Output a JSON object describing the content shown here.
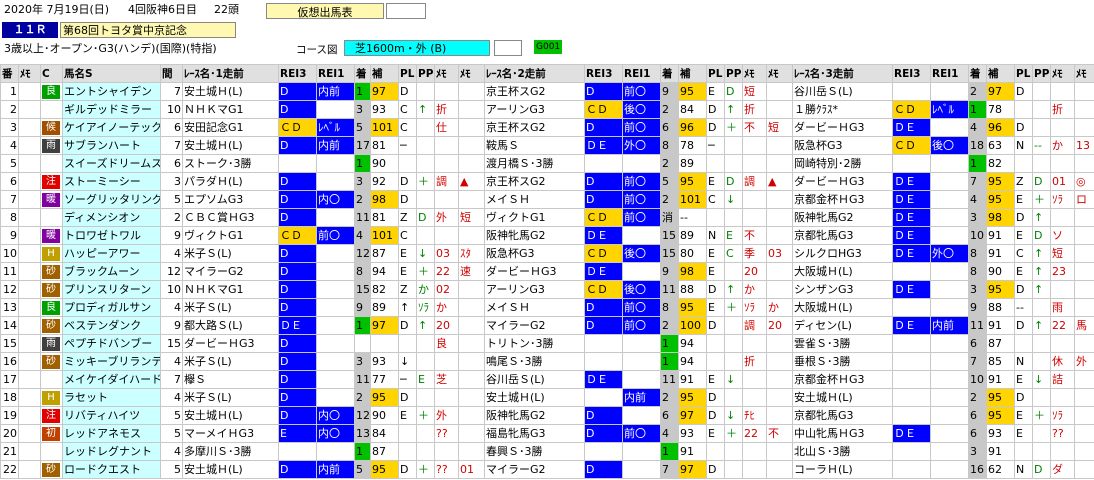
{
  "header": {
    "date": "2020年 7月19日(日)",
    "meet": "4回阪神6日目",
    "runners": "22頭",
    "tab": "仮想出馬表",
    "race_no": "１１Ｒ",
    "race_name": "第68回トヨタ賞中京記念",
    "conditions": "3歳以上･オープン･G3(ハンデ)(国際)(特指)",
    "course_label": "コース図",
    "course": "芝1600m・外 (B)",
    "code": "G001"
  },
  "cols": [
    "番",
    "ﾒﾓ",
    "C",
    "馬名S",
    "間",
    "ﾚｰｽ名･1走前",
    "REI3",
    "REI1",
    "着",
    "補",
    "PL",
    "PP",
    "ﾒﾓ",
    "ﾒﾓ",
    "ﾚｰｽ名･2走前",
    "REI3",
    "REI1",
    "着",
    "補",
    "PL",
    "PP",
    "ﾒﾓ",
    "ﾒﾓ",
    "ﾚｰｽ名･3走前",
    "REI3",
    "REI1",
    "着",
    "補",
    "PL",
    "PP",
    "ﾒﾓ",
    "ﾒﾓ"
  ],
  "horses": [
    {
      "n": "1",
      "mk": "良",
      "mc": "#00a000",
      "name": "エントシャイデン",
      "gap": "7",
      "r1": "安土城Ｈ(L)",
      "r1a": "D",
      "r1b": "内前",
      "r1c": "1",
      "r1d": "97",
      "r1e": "D",
      "r1f": "",
      "r1g": "",
      "r1h": "",
      "r2": "京王杯スG2",
      "r2a": "D",
      "r2b": "前〇",
      "r2c": "9",
      "r2d": "95",
      "r2e": "E",
      "r2f": "D",
      "r2g": "短",
      "r2h": "",
      "r3": "谷川岳Ｓ(L)",
      "r3a": "",
      "r3b": "",
      "r3c": "2",
      "r3d": "97",
      "r3e": "D",
      "r3f": "",
      "r3g": "",
      "r3h": ""
    },
    {
      "n": "2",
      "mk": "",
      "mc": "",
      "name": "ギルデッドミラー",
      "gap": "10",
      "r1": "ＮＨＫマG1",
      "r1a": "D",
      "r1b": "",
      "r1c": "3",
      "r1d": "93",
      "r1e": "C",
      "r1f": "↑",
      "r1g": "折",
      "r1h": "",
      "r2": "アーリンG3",
      "r2a": "ＣＤ",
      "r2b": "後〇",
      "r2c": "2",
      "r2d": "84",
      "r2e": "D",
      "r2f": "↑",
      "r2g": "折",
      "r2h": "",
      "r3": "１勝ｸﾗｽ*",
      "r3a": "ＣＤ",
      "r3b": "ﾚﾍﾞﾙ",
      "r3c": "1",
      "r3d": "78",
      "r3e": "",
      "r3f": "",
      "r3g": "折",
      "r3h": ""
    },
    {
      "n": "3",
      "mk": "候",
      "mc": "#a05000",
      "name": "ケイアイノーテック",
      "gap": "6",
      "r1": "安田記念G1",
      "r1a": "ＣＤ",
      "r1b": "ﾚﾍﾞﾙ",
      "r1c": "5",
      "r1d": "101",
      "r1e": "C",
      "r1f": "",
      "r1g": "仕",
      "r1h": "",
      "r2": "京王杯スG2",
      "r2a": "D",
      "r2b": "前〇",
      "r2c": "6",
      "r2d": "96",
      "r2e": "D",
      "r2f": "＋",
      "r2g": "不",
      "r2h": "短",
      "r3": "ダービーＨG3",
      "r3a": "ＤＥ",
      "r3b": "",
      "r3c": "4",
      "r3d": "96",
      "r3e": "D",
      "r3f": "",
      "r3g": "",
      "r3h": ""
    },
    {
      "n": "4",
      "mk": "雨",
      "mc": "#404040",
      "name": "サブランハート",
      "gap": "7",
      "r1": "安土城Ｈ(L)",
      "r1a": "D",
      "r1b": "内前",
      "r1c": "17",
      "r1d": "81",
      "r1e": "─",
      "r1f": "",
      "r1g": "",
      "r1h": "",
      "r2": "鞍馬Ｓ",
      "r2a": "ＤＥ",
      "r2b": "外〇",
      "r2c": "8",
      "r2d": "78",
      "r2e": "─",
      "r2f": "",
      "r2g": "",
      "r2h": "",
      "r3": "阪急杯G3",
      "r3a": "ＣＤ",
      "r3b": "後〇",
      "r3c": "18",
      "r3d": "63",
      "r3e": "N",
      "r3f": "--",
      "r3g": "か",
      "r3h": "13"
    },
    {
      "n": "5",
      "mk": "",
      "mc": "",
      "name": "スイーズドリームス",
      "gap": "6",
      "r1": "ストーク･3勝",
      "r1a": "",
      "r1b": "",
      "r1c": "1",
      "r1d": "90",
      "r1e": "",
      "r1f": "",
      "r1g": "",
      "r1h": "",
      "r2": "渡月橋Ｓ･3勝",
      "r2a": "",
      "r2b": "",
      "r2c": "2",
      "r2d": "89",
      "r2e": "",
      "r2f": "",
      "r2g": "",
      "r2h": "",
      "r3": "岡崎特別･2勝",
      "r3a": "",
      "r3b": "",
      "r3c": "1",
      "r3d": "82",
      "r3e": "",
      "r3f": "",
      "r3g": "",
      "r3h": ""
    },
    {
      "n": "6",
      "mk": "注",
      "mc": "#e00000",
      "name": "ストーミーシー",
      "gap": "3",
      "r1": "パラダＨ(L)",
      "r1a": "D",
      "r1b": "",
      "r1c": "3",
      "r1d": "92",
      "r1e": "D",
      "r1f": "＋",
      "r1g": "調",
      "r1h": "▲",
      "r2": "京王杯スG2",
      "r2a": "D",
      "r2b": "前〇",
      "r2c": "5",
      "r2d": "95",
      "r2e": "E",
      "r2f": "D",
      "r2g": "調",
      "r2h": "▲",
      "r3": "ダービーＨG3",
      "r3a": "ＤＥ",
      "r3b": "",
      "r3c": "7",
      "r3d": "95",
      "r3e": "Z",
      "r3f": "D",
      "r3g": "01",
      "r3h": "◎"
    },
    {
      "n": "7",
      "mk": "暖",
      "mc": "#8000a0",
      "name": "ソーグリッタリング",
      "gap": "5",
      "r1": "エプソムG3",
      "r1a": "D",
      "r1b": "内〇",
      "r1c": "2",
      "r1d": "98",
      "r1e": "D",
      "r1f": "",
      "r1g": "",
      "r1h": "",
      "r2": "メイＳＨ",
      "r2a": "D",
      "r2b": "前〇",
      "r2c": "2",
      "r2d": "101",
      "r2e": "C",
      "r2f": "↓",
      "r2g": "",
      "r2h": "",
      "r3": "京都金杯ＨG3",
      "r3a": "ＤＥ",
      "r3b": "",
      "r3c": "4",
      "r3d": "95",
      "r3e": "E",
      "r3f": "＋",
      "r3g": "ｿﾗ",
      "r3h": "ロ"
    },
    {
      "n": "8",
      "mk": "",
      "mc": "",
      "name": "ディメンシオン",
      "gap": "2",
      "r1": "ＣＢＣ賞ＨG3",
      "r1a": "D",
      "r1b": "",
      "r1c": "11",
      "r1d": "81",
      "r1e": "Z",
      "r1f": "D",
      "r1g": "外",
      "r1h": "短",
      "r2": "ヴィクトG1",
      "r2a": "ＣＤ",
      "r2b": "前〇",
      "r2c": "消",
      "r2d": "--",
      "r2e": "",
      "r2f": "",
      "r2g": "",
      "r2h": "",
      "r3": "阪神牝馬G2",
      "r3a": "ＤＥ",
      "r3b": "",
      "r3c": "3",
      "r3d": "98",
      "r3e": "D",
      "r3f": "↑",
      "r3g": "",
      "r3h": ""
    },
    {
      "n": "9",
      "mk": "暖",
      "mc": "#8000a0",
      "name": "トロワゼトワル",
      "gap": "9",
      "r1": "ヴィクトG1",
      "r1a": "ＣＤ",
      "r1b": "前〇",
      "r1c": "4",
      "r1d": "101",
      "r1e": "C",
      "r1f": "",
      "r1g": "",
      "r1h": "",
      "r2": "阪神牝馬G2",
      "r2a": "ＤＥ",
      "r2b": "",
      "r2c": "15",
      "r2d": "89",
      "r2e": "N",
      "r2f": "E",
      "r2g": "不",
      "r2h": "",
      "r3": "京都牝馬G3",
      "r3a": "ＤＥ",
      "r3b": "",
      "r3c": "10",
      "r3d": "91",
      "r3e": "E",
      "r3f": "D",
      "r3g": "ソ",
      "r3h": ""
    },
    {
      "n": "10",
      "mk": "H",
      "mc": "#c0a000",
      "name": "ハッピーアワー",
      "gap": "4",
      "r1": "米子Ｓ(L)",
      "r1a": "D",
      "r1b": "",
      "r1c": "12",
      "r1d": "87",
      "r1e": "E",
      "r1f": "↓",
      "r1g": "03",
      "r1h": "ｽﾀ",
      "r2": "阪急杯G3",
      "r2a": "ＣＤ",
      "r2b": "後〇",
      "r2c": "15",
      "r2d": "80",
      "r2e": "E",
      "r2f": "C",
      "r2g": "季",
      "r2h": "03",
      "r3": "シルクロHG3",
      "r3a": "ＤＥ",
      "r3b": "外〇",
      "r3c": "8",
      "r3d": "91",
      "r3e": "C",
      "r3f": "↑",
      "r3g": "短",
      "r3h": ""
    },
    {
      "n": "11",
      "mk": "砂",
      "mc": "#a06000",
      "name": "ブラックムーン",
      "gap": "12",
      "r1": "マイラーG2",
      "r1a": "D",
      "r1b": "",
      "r1c": "8",
      "r1d": "94",
      "r1e": "E",
      "r1f": "＋",
      "r1g": "22",
      "r1h": "速",
      "r2": "ダービーＨG3",
      "r2a": "ＤＥ",
      "r2b": "",
      "r2c": "9",
      "r2d": "98",
      "r2e": "E",
      "r2f": "",
      "r2g": "20",
      "r2h": "",
      "r3": "大阪城Ｈ(L)",
      "r3a": "",
      "r3b": "",
      "r3c": "8",
      "r3d": "90",
      "r3e": "E",
      "r3f": "↑",
      "r3g": "23",
      "r3h": ""
    },
    {
      "n": "12",
      "mk": "砂",
      "mc": "#a06000",
      "name": "プリンスリターン",
      "gap": "10",
      "r1": "ＮＨＫマG1",
      "r1a": "D",
      "r1b": "",
      "r1c": "15",
      "r1d": "82",
      "r1e": "Z",
      "r1f": "か",
      "r1g": "02",
      "r1h": "",
      "r2": "アーリンG3",
      "r2a": "ＣＤ",
      "r2b": "後〇",
      "r2c": "11",
      "r2d": "88",
      "r2e": "D",
      "r2f": "↑",
      "r2g": "か",
      "r2h": "",
      "r3": "シンザンG3",
      "r3a": "ＤＥ",
      "r3b": "",
      "r3c": "3",
      "r3d": "95",
      "r3e": "D",
      "r3f": "↑",
      "r3g": "",
      "r3h": ""
    },
    {
      "n": "13",
      "mk": "良",
      "mc": "#00a000",
      "name": "プロディガルサン",
      "gap": "4",
      "r1": "米子Ｓ(L)",
      "r1a": "D",
      "r1b": "",
      "r1c": "9",
      "r1d": "89",
      "r1e": "↑",
      "r1f": "ｿﾗ",
      "r1g": "か",
      "r1h": "",
      "r2": "メイＳＨ",
      "r2a": "D",
      "r2b": "前〇",
      "r2c": "8",
      "r2d": "95",
      "r2e": "E",
      "r2f": "＋",
      "r2g": "ｿﾗ",
      "r2h": "か",
      "r3": "大阪城Ｈ(L)",
      "r3a": "",
      "r3b": "",
      "r3c": "9",
      "r3d": "88",
      "r3e": "--",
      "r3f": "",
      "r3g": "雨",
      "r3h": ""
    },
    {
      "n": "14",
      "mk": "砂",
      "mc": "#a06000",
      "name": "ベステンダンク",
      "gap": "9",
      "r1": "都大路Ｓ(L)",
      "r1a": "ＤＥ",
      "r1b": "",
      "r1c": "1",
      "r1d": "97",
      "r1e": "D",
      "r1f": "↑",
      "r1g": "20",
      "r1h": "",
      "r2": "マイラーG2",
      "r2a": "D",
      "r2b": "前〇",
      "r2c": "2",
      "r2d": "100",
      "r2e": "D",
      "r2f": "",
      "r2g": "調",
      "r2h": "20",
      "r3": "ディセン(L)",
      "r3a": "ＤＥ",
      "r3b": "内前",
      "r3c": "11",
      "r3d": "91",
      "r3e": "D",
      "r3f": "↑",
      "r3g": "22",
      "r3h": "馬"
    },
    {
      "n": "15",
      "mk": "雨",
      "mc": "#404040",
      "name": "ペプチドバンブー",
      "gap": "15",
      "r1": "ダービーＨG3",
      "r1a": "D",
      "r1b": "",
      "r1c": "",
      "r1d": "",
      "r1e": "",
      "r1f": "",
      "r1g": "良",
      "r1h": "",
      "r2": "トリトン･3勝",
      "r2a": "",
      "r2b": "",
      "r2c": "1",
      "r2d": "94",
      "r2e": "",
      "r2f": "",
      "r2g": "",
      "r2h": "",
      "r3": "雲雀Ｓ･3勝",
      "r3a": "",
      "r3b": "",
      "r3c": "6",
      "r3d": "87",
      "r3e": "",
      "r3f": "",
      "r3g": "",
      "r3h": ""
    },
    {
      "n": "16",
      "mk": "砂",
      "mc": "#a06000",
      "name": "ミッキーブリランテ",
      "gap": "4",
      "r1": "米子Ｓ(L)",
      "r1a": "D",
      "r1b": "",
      "r1c": "3",
      "r1d": "93",
      "r1e": "↓",
      "r1f": "",
      "r1g": "",
      "r1h": "",
      "r2": "鳴尾Ｓ･3勝",
      "r2a": "",
      "r2b": "",
      "r2c": "1",
      "r2d": "94",
      "r2e": "",
      "r2f": "",
      "r2g": "折",
      "r2h": "",
      "r3": "垂根Ｓ･3勝",
      "r3a": "",
      "r3b": "",
      "r3c": "7",
      "r3d": "85",
      "r3e": "N",
      "r3f": "",
      "r3g": "休",
      "r3h": "外"
    },
    {
      "n": "17",
      "mk": "",
      "mc": "",
      "name": "メイケイダイハード",
      "gap": "7",
      "r1": "欅Ｓ",
      "r1a": "D",
      "r1b": "",
      "r1c": "11",
      "r1d": "77",
      "r1e": "─",
      "r1f": "E",
      "r1g": "芝",
      "r1h": "",
      "r2": "谷川岳Ｓ(L)",
      "r2a": "ＤＥ",
      "r2b": "",
      "r2c": "11",
      "r2d": "91",
      "r2e": "E",
      "r2f": "↓",
      "r2g": "",
      "r2h": "",
      "r3": "京都金杯ＨG3",
      "r3a": "",
      "r3b": "",
      "r3c": "10",
      "r3d": "91",
      "r3e": "E",
      "r3f": "↓",
      "r3g": "詰",
      "r3h": ""
    },
    {
      "n": "18",
      "mk": "H",
      "mc": "#c0a000",
      "name": "ラセット",
      "gap": "4",
      "r1": "米子Ｓ(L)",
      "r1a": "D",
      "r1b": "",
      "r1c": "2",
      "r1d": "95",
      "r1e": "D",
      "r1f": "",
      "r1g": "",
      "r1h": "",
      "r2": "安土城Ｈ(L)",
      "r2a": "",
      "r2b": "内前",
      "r2c": "2",
      "r2d": "95",
      "r2e": "D",
      "r2f": "",
      "r2g": "",
      "r2h": "",
      "r3": "安土城Ｈ(L)",
      "r3a": "",
      "r3b": "",
      "r3c": "2",
      "r3d": "95",
      "r3e": "D",
      "r3f": "",
      "r3g": "",
      "r3h": ""
    },
    {
      "n": "19",
      "mk": "注",
      "mc": "#e00000",
      "name": "リバティハイツ",
      "gap": "5",
      "r1": "安土城Ｈ(L)",
      "r1a": "D",
      "r1b": "内〇",
      "r1c": "12",
      "r1d": "90",
      "r1e": "E",
      "r1f": "＋",
      "r1g": "外",
      "r1h": "",
      "r2": "阪神牝馬G2",
      "r2a": "D",
      "r2b": "",
      "r2c": "6",
      "r2d": "97",
      "r2e": "D",
      "r2f": "↓",
      "r2g": "ﾁﾋ",
      "r2h": "",
      "r3": "京都牝馬G3",
      "r3a": "",
      "r3b": "",
      "r3c": "6",
      "r3d": "95",
      "r3e": "E",
      "r3f": "＋",
      "r3g": "ｿﾗ",
      "r3h": ""
    },
    {
      "n": "20",
      "mk": "初",
      "mc": "#c04000",
      "name": "レッドアネモス",
      "gap": "5",
      "r1": "マーメイＨG3",
      "r1a": "E",
      "r1b": "内〇",
      "r1c": "13",
      "r1d": "84",
      "r1e": "",
      "r1f": "",
      "r1g": "??",
      "r1h": "",
      "r2": "福島牝馬G3",
      "r2a": "D",
      "r2b": "前〇",
      "r2c": "4",
      "r2d": "93",
      "r2e": "E",
      "r2f": "＋",
      "r2g": "22",
      "r2h": "不",
      "r3": "中山牝馬ＨG3",
      "r3a": "ＤＥ",
      "r3b": "",
      "r3c": "6",
      "r3d": "93",
      "r3e": "E",
      "r3f": "",
      "r3g": "??",
      "r3h": ""
    },
    {
      "n": "21",
      "mk": "",
      "mc": "",
      "name": "レッドレグナント",
      "gap": "4",
      "r1": "多摩川Ｓ･3勝",
      "r1a": "",
      "r1b": "",
      "r1c": "1",
      "r1d": "87",
      "r1e": "",
      "r1f": "",
      "r1g": "",
      "r1h": "",
      "r2": "春興Ｓ･3勝",
      "r2a": "",
      "r2b": "",
      "r2c": "1",
      "r2d": "91",
      "r2e": "",
      "r2f": "",
      "r2g": "",
      "r2h": "",
      "r3": "北山Ｓ･3勝",
      "r3a": "",
      "r3b": "",
      "r3c": "3",
      "r3d": "91",
      "r3e": "",
      "r3f": "",
      "r3g": "",
      "r3h": ""
    },
    {
      "n": "22",
      "mk": "砂",
      "mc": "#a06000",
      "name": "ロードクエスト",
      "gap": "5",
      "r1": "安土城Ｈ(L)",
      "r1a": "D",
      "r1b": "内前",
      "r1c": "5",
      "r1d": "95",
      "r1e": "D",
      "r1f": "＋",
      "r1g": "??",
      "r1h": "01",
      "r2": "マイラーG2",
      "r2a": "D",
      "r2b": "",
      "r2c": "7",
      "r2d": "97",
      "r2e": "D",
      "r2f": "",
      "r2g": "",
      "r2h": "",
      "r3": "コーラＨ(L)",
      "r3a": "",
      "r3b": "",
      "r3c": "16",
      "r3d": "62",
      "r3e": "N",
      "r3f": "D",
      "r3g": "ダ",
      "r3h": ""
    }
  ]
}
